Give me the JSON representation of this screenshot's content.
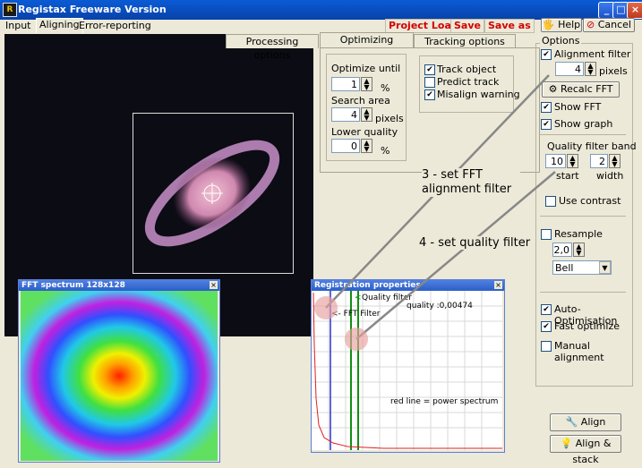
{
  "window": {
    "title": "Registax Freeware Version"
  },
  "menu": {
    "tabs": [
      "Input",
      "Aligning",
      "Error-reporting"
    ],
    "selected": "Aligning"
  },
  "actions": {
    "project_load": "Project Load",
    "save": "Save",
    "save_as": "Save as",
    "help": "Help",
    "cancel": "Cancel"
  },
  "subtabs": {
    "processing": "Processing options",
    "optimizing": "Optimizing options",
    "tracking": "Tracking options",
    "selected": "Optimizing options"
  },
  "optimizing": {
    "optimize_until_label": "Optimize until",
    "optimize_until_value": "1",
    "optimize_until_unit": "%",
    "search_area_label": "Search area",
    "search_area_value": "4",
    "search_area_unit": "pixels",
    "lower_quality_label": "Lower quality",
    "lower_quality_value": "0",
    "lower_quality_unit": "%"
  },
  "tracking": {
    "track_object": {
      "label": "Track object",
      "checked": true
    },
    "predict_track": {
      "label": "Predict track",
      "checked": false
    },
    "misalign_warning": {
      "label": "Misalign warning",
      "checked": true
    }
  },
  "options": {
    "title": "Options",
    "alignment_filter": {
      "label": "Alignment filter",
      "checked": true,
      "value": "4",
      "unit": "pixels"
    },
    "recalc_fft": "Recalc FFT",
    "show_fft": {
      "label": "Show FFT",
      "checked": true
    },
    "show_graph": {
      "label": "Show graph",
      "checked": true
    },
    "quality_filter_band": {
      "label": "Quality filter band",
      "start_value": "10",
      "start_label": "start",
      "width_value": "2",
      "width_label": "width"
    },
    "use_contrast": {
      "label": "Use contrast",
      "checked": false
    },
    "resample": {
      "label": "Resample",
      "checked": false,
      "value": "2,0",
      "method": "Bell"
    },
    "auto_optimisation": {
      "label": "Auto-Optimisation",
      "checked": true
    },
    "fast_optimize": {
      "label": "Fast optimize",
      "checked": true
    },
    "manual_alignment": {
      "label": "Manual alignment",
      "checked": false
    }
  },
  "buttons": {
    "align": "Align",
    "align_stack": "Align & stack"
  },
  "fft_window": {
    "title": "FFT spectrum 128x128"
  },
  "registration": {
    "title": "Registration properties",
    "quality_filter": "Quality filter",
    "fft_filter": "FFT Filter",
    "quality_readout": "quality :0,00474",
    "power_note": "red line = power spectrum"
  },
  "annotations": {
    "step3": "3 - set FFT alignment filter",
    "step4": "4 - set quality filter"
  },
  "colors": {
    "title_blue": "#0842a8",
    "link_red": "#d40000",
    "annotation_circle": "#e8a0a0"
  }
}
